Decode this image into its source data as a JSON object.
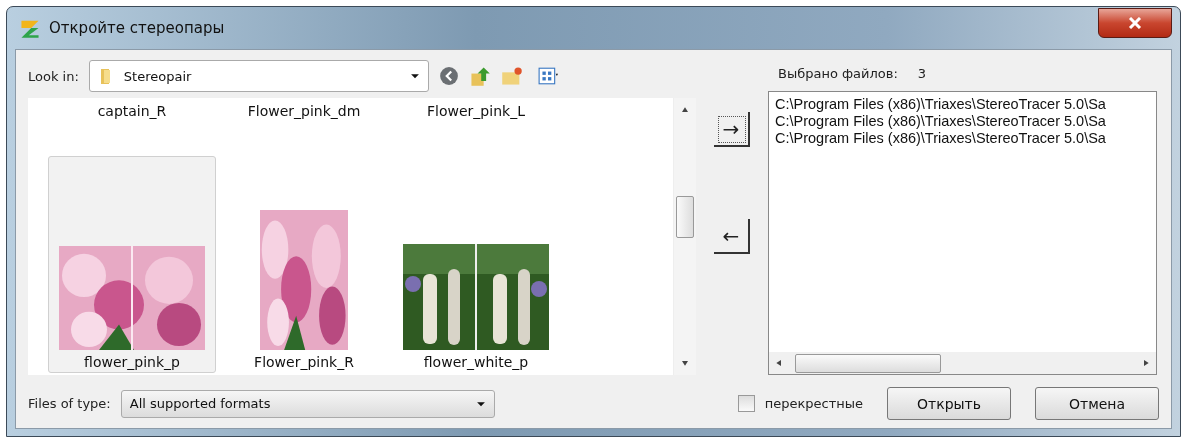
{
  "window": {
    "title": "Откройте стереопары"
  },
  "look_in": {
    "label": "Look in:",
    "value": "Stereopair"
  },
  "files": [
    {
      "name": "captain_R",
      "kind": "name_only",
      "selected": false
    },
    {
      "name": "Flower_pink_dm",
      "kind": "name_only",
      "selected": false
    },
    {
      "name": "Flower_pink_L",
      "kind": "name_only",
      "selected": false
    },
    {
      "name": "flower_pink_p",
      "kind": "thumbnail",
      "selected": true
    },
    {
      "name": "Flower_pink_R",
      "kind": "thumbnail",
      "selected": false
    },
    {
      "name": "flower_white_p",
      "kind": "thumbnail",
      "selected": false
    }
  ],
  "move_buttons": [
    {
      "label": "→",
      "focused": true
    },
    {
      "label": "←",
      "focused": false
    }
  ],
  "selected_count": {
    "label": "Выбрано файлов:",
    "value": "3"
  },
  "selected_files": [
    "C:\\Program Files (x86)\\Triaxes\\StereoTracer 5.0\\Sa",
    "C:\\Program Files (x86)\\Triaxes\\StereoTracer 5.0\\Sa",
    "C:\\Program Files (x86)\\Triaxes\\StereoTracer 5.0\\Sa"
  ],
  "files_of_type": {
    "label": "Files of type:",
    "value": "All supported formats"
  },
  "cross_checkbox": {
    "label": "перекрестные",
    "checked": false
  },
  "buttons": [
    "Открыть",
    "Отмена"
  ]
}
